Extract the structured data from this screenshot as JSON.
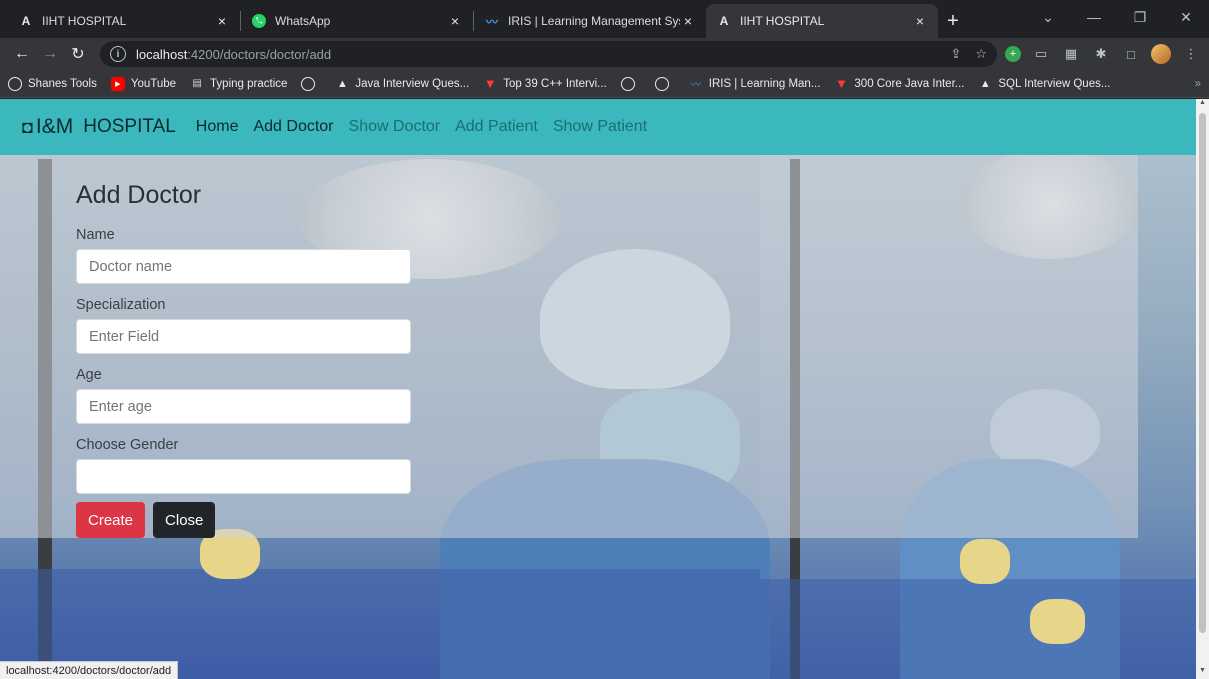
{
  "browser": {
    "tabs": [
      {
        "favicon": "A",
        "title": "IIHT HOSPITAL",
        "active": false
      },
      {
        "favicon": "whatsapp-icon",
        "title": "WhatsApp",
        "active": false
      },
      {
        "favicon": "iris-icon",
        "title": "IRIS | Learning Management Syst",
        "active": false
      },
      {
        "favicon": "A",
        "title": "IIHT HOSPITAL",
        "active": true
      }
    ],
    "close_glyph": "×",
    "new_tab_glyph": "+",
    "url_host": "localhost",
    "url_path": ":4200/doctors/doctor/add",
    "bookmarks": [
      {
        "icon": "globe-icon",
        "label": "Shanes Tools"
      },
      {
        "icon": "youtube-icon",
        "label": "YouTube"
      },
      {
        "icon": "folder-icon",
        "label": "Typing practice"
      },
      {
        "icon": "globe-icon",
        "label": ""
      },
      {
        "icon": "triangle-icon",
        "label": "Java Interview Ques..."
      },
      {
        "icon": "v-logo-icon",
        "label": "Top 39 C++ Intervi..."
      },
      {
        "icon": "globe-icon",
        "label": ""
      },
      {
        "icon": "globe-icon",
        "label": ""
      },
      {
        "icon": "iris-icon",
        "label": "IRIS | Learning Man..."
      },
      {
        "icon": "v-logo-icon",
        "label": "300 Core Java Inter..."
      },
      {
        "icon": "triangle-icon",
        "label": "SQL Interview Ques..."
      }
    ],
    "status_url": "localhost:4200/doctors/doctor/add"
  },
  "app": {
    "brand_logo": "I&M",
    "brand_name": "HOSPITAL",
    "nav": [
      "Home",
      "Add Doctor",
      "Show Doctor",
      "Add Patient",
      "Show Patient"
    ],
    "accent_color": "#3ab8bd"
  },
  "form": {
    "title": "Add Doctor",
    "fields": [
      {
        "label": "Name",
        "placeholder": "Doctor name",
        "value": ""
      },
      {
        "label": "Specialization",
        "placeholder": "Enter Field",
        "value": ""
      },
      {
        "label": "Age",
        "placeholder": "Enter age",
        "value": ""
      },
      {
        "label": "Choose Gender",
        "placeholder": "",
        "value": ""
      }
    ],
    "create_label": "Create",
    "close_label": "Close"
  }
}
